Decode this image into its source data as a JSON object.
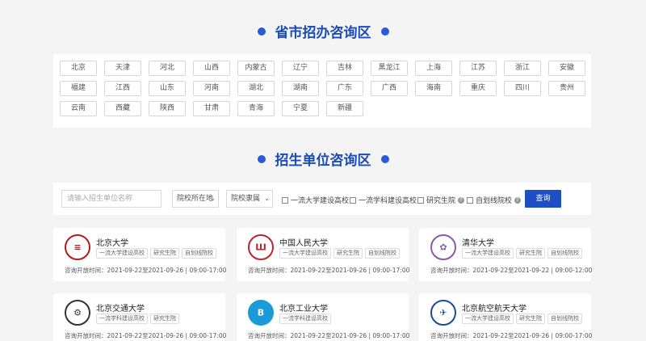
{
  "sections": {
    "province_title": "省市招办咨询区",
    "unit_title": "招生单位咨询区"
  },
  "provinces": [
    "北京",
    "天津",
    "河北",
    "山西",
    "内蒙古",
    "辽宁",
    "吉林",
    "黑龙江",
    "上海",
    "江苏",
    "浙江",
    "安徽",
    "福建",
    "江西",
    "山东",
    "河南",
    "湖北",
    "湖南",
    "广东",
    "广西",
    "海南",
    "重庆",
    "四川",
    "贵州",
    "云南",
    "西藏",
    "陕西",
    "甘肃",
    "青海",
    "宁夏",
    "新疆"
  ],
  "filter": {
    "search_placeholder": "请输入招生单位名称",
    "location_select": "院校所在地",
    "affiliation_select": "院校隶属",
    "checkboxes": [
      "一流大学建设高校",
      "一流学科建设高校",
      "研究生院",
      "自划线院校"
    ],
    "query_button": "查询"
  },
  "universities": [
    {
      "name": "北京大学",
      "tags": [
        "一流大学建设高校",
        "研究生院",
        "自划线院校"
      ],
      "time": "咨询开放时间：2021-09-22至2021-09-26 | 09:00-17:00",
      "logo_color": "#b31b1b"
    },
    {
      "name": "中国人民大学",
      "tags": [
        "一流大学建设高校",
        "研究生院",
        "自划线院校"
      ],
      "time": "咨询开放时间：2021-09-22至2021-09-26 | 09:00-17:00",
      "logo_color": "#b3282d"
    },
    {
      "name": "清华大学",
      "tags": [
        "一流大学建设高校",
        "研究生院",
        "自划线院校"
      ],
      "time": "咨询开放时间：2021-09-22至2021-09-22 | 09:00-12:00",
      "logo_color": "#8a5aa8"
    },
    {
      "name": "北京交通大学",
      "tags": [
        "一流学科建设高校",
        "研究生院"
      ],
      "time": "咨询开放时间：2021-09-22至2021-09-26 | 09:00-17:00",
      "logo_color": "#333333"
    },
    {
      "name": "北京工业大学",
      "tags": [
        "一流学科建设高校"
      ],
      "time": "咨询开放时间：2021-09-22至2021-09-26 | 09:00-17:00",
      "logo_color": "#1a9ad6"
    },
    {
      "name": "北京航空航天大学",
      "tags": [
        "一流大学建设高校",
        "研究生院",
        "自划线院校"
      ],
      "time": "咨询开放时间：2021-09-22至2021-09-26 | 09:00-17:00",
      "logo_color": "#1b4b9b"
    }
  ]
}
